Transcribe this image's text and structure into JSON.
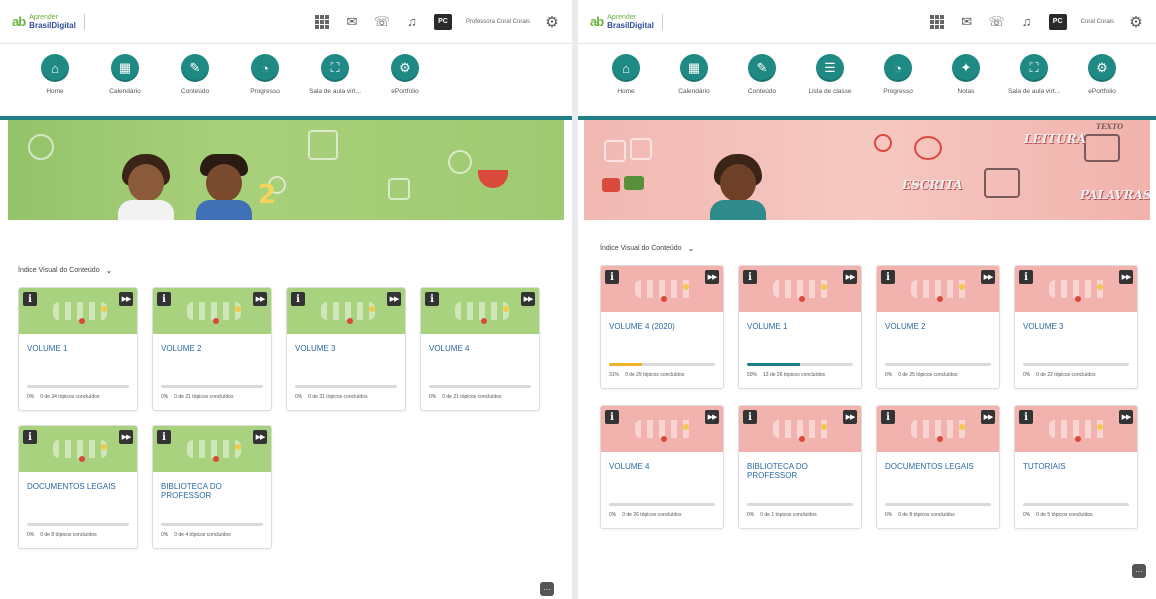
{
  "left": {
    "logo": {
      "mark": "ab",
      "line1": "Aprender",
      "line2": "BrasilDigital"
    },
    "user": {
      "initials": "PC",
      "name": "Professora Coral Corais"
    },
    "nav": [
      {
        "label": "Home",
        "icon": "home-icon",
        "glyph": "⌂"
      },
      {
        "label": "Calendário",
        "icon": "calendar-icon",
        "glyph": "▦"
      },
      {
        "label": "Conteúdo",
        "icon": "content-icon",
        "glyph": "✎"
      },
      {
        "label": "Progresso",
        "icon": "progress-icon",
        "glyph": "◔"
      },
      {
        "label": "Sala de aula virt...",
        "icon": "classroom-icon",
        "glyph": "⛶"
      },
      {
        "label": "ePortfolio",
        "icon": "eportfolio-icon",
        "glyph": "⚙"
      }
    ],
    "index_title": "Índice Visual do Conteúdo",
    "cards": [
      {
        "title": "VOLUME 1",
        "percent": 0,
        "meta_percent": "0%",
        "meta_text": "0 de 34 tópicos concluídos"
      },
      {
        "title": "VOLUME 2",
        "percent": 0,
        "meta_percent": "0%",
        "meta_text": "0 de 21 tópicos concluídos"
      },
      {
        "title": "VOLUME 3",
        "percent": 0,
        "meta_percent": "0%",
        "meta_text": "0 de 31 tópicos concluídos"
      },
      {
        "title": "VOLUME 4",
        "percent": 0,
        "meta_percent": "0%",
        "meta_text": "0 de 21 tópicos concluídos"
      },
      {
        "title": "DOCUMENTOS LEGAIS",
        "percent": 0,
        "meta_percent": "0%",
        "meta_text": "0 de 8 tópicos concluídos"
      },
      {
        "title": "BIBLIOTECA DO PROFESSOR",
        "percent": 0,
        "meta_percent": "0%",
        "meta_text": "0 de 4 tópicos concluídos"
      }
    ]
  },
  "right": {
    "logo": {
      "mark": "ab",
      "line1": "Aprender",
      "line2": "BrasilDigital"
    },
    "user": {
      "initials": "PC",
      "name": "Coral Corais"
    },
    "nav": [
      {
        "label": "Home",
        "icon": "home-icon",
        "glyph": "⌂"
      },
      {
        "label": "Calendário",
        "icon": "calendar-icon",
        "glyph": "▦"
      },
      {
        "label": "Conteúdo",
        "icon": "content-icon",
        "glyph": "✎"
      },
      {
        "label": "Lista de classe",
        "icon": "class-list-icon",
        "glyph": "☰"
      },
      {
        "label": "Progresso",
        "icon": "progress-icon",
        "glyph": "◔"
      },
      {
        "label": "Notas",
        "icon": "grades-icon",
        "glyph": "✦"
      },
      {
        "label": "Sala de aula virt...",
        "icon": "classroom-icon",
        "glyph": "⛶"
      },
      {
        "label": "ePortfolio",
        "icon": "eportfolio-icon",
        "glyph": "⚙"
      }
    ],
    "banner_words": [
      "LEITURA",
      "ESCRITA",
      "PALAVRAS",
      "TEXTO"
    ],
    "index_title": "Índice Visual do Conteúdo",
    "cards": [
      {
        "title": "VOLUME 4 (2020)",
        "percent": 31,
        "meta_percent": "31%",
        "meta_text": "9 de 29 tópicos concluídos",
        "fill": "#f0b429"
      },
      {
        "title": "VOLUME 1",
        "percent": 50,
        "meta_percent": "50%",
        "meta_text": "13 de 26 tópicos concluídos",
        "fill": "#1f7f84"
      },
      {
        "title": "VOLUME 2",
        "percent": 0,
        "meta_percent": "0%",
        "meta_text": "0 de 25 tópicos concluídos",
        "fill": "#1f7f84"
      },
      {
        "title": "VOLUME 3",
        "percent": 0,
        "meta_percent": "0%",
        "meta_text": "0 de 22 tópicos concluídos",
        "fill": "#1f7f84"
      },
      {
        "title": "VOLUME 4",
        "percent": 0,
        "meta_percent": "0%",
        "meta_text": "0 de 26 tópicos concluídos",
        "fill": "#1f7f84"
      },
      {
        "title": "BIBLIOTECA DO PROFESSOR",
        "percent": 0,
        "meta_percent": "0%",
        "meta_text": "0 de 1 tópicos concluídos",
        "fill": "#1f7f84"
      },
      {
        "title": "DOCUMENTOS LEGAIS",
        "percent": 0,
        "meta_percent": "0%",
        "meta_text": "0 de 8 tópicos concluídos",
        "fill": "#1f7f84"
      },
      {
        "title": "TUTORIAIS",
        "percent": 0,
        "meta_percent": "0%",
        "meta_text": "0 de 5 tópicos concluídos",
        "fill": "#1f7f84"
      }
    ]
  },
  "colors": {
    "teal": "#1f8a84",
    "link_blue": "#2b6aa3",
    "green_banner": "#a8d27e",
    "pink_banner": "#f2b2ad"
  },
  "more_button": "···"
}
